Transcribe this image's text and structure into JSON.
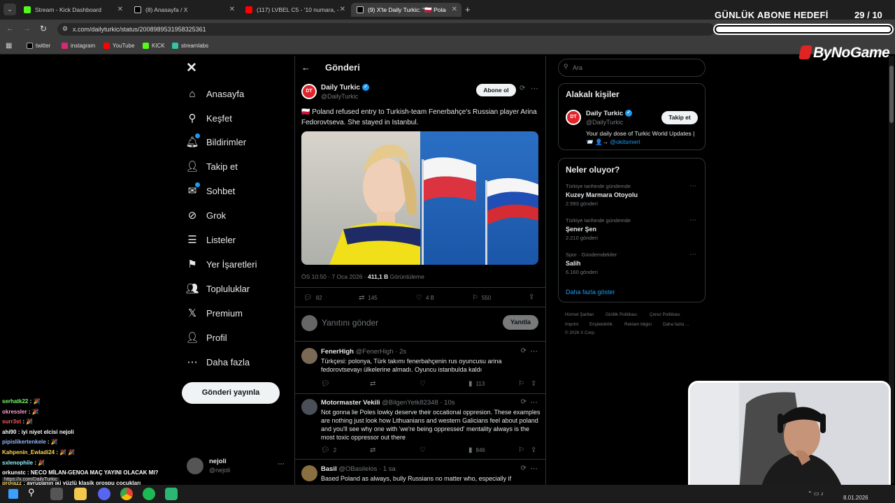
{
  "browser": {
    "tabs": [
      {
        "title": "Stream - Kick Dashboard",
        "color": "#53fc18"
      },
      {
        "title": "(8) Anasayfa / X",
        "color": "#ffffff"
      },
      {
        "title": "(117) LVBEL C5 - '10 numara, -",
        "color": "#ff0000"
      },
      {
        "title": "(9) X'te Daily Turkic: \"🇵🇱 Poland",
        "color": "#ffffff"
      }
    ],
    "url": "x.com/dailyturkic/status/2008989531958325361",
    "bookmarks": [
      "twitter",
      "instagram",
      "YouTube",
      "KICK",
      "streamlabs"
    ]
  },
  "overlay": {
    "goal_title": "GÜNLÜK ABONE HEDEFİ",
    "goal_current": "29",
    "goal_target": "/ 10",
    "goal_fill": 1.0,
    "brand": "ByNoGame",
    "date": "8.01.2026"
  },
  "nav": {
    "items": [
      {
        "label": "Anasayfa",
        "icon": "home-icon",
        "glyph": "⌂"
      },
      {
        "label": "Keşfet",
        "icon": "search-icon",
        "glyph": "⚲"
      },
      {
        "label": "Bildirimler",
        "icon": "bell-icon",
        "glyph": "🔔︎"
      },
      {
        "label": "Takip et",
        "icon": "follow-icon",
        "glyph": "👤︎"
      },
      {
        "label": "Sohbet",
        "icon": "chat-icon",
        "glyph": "✉"
      },
      {
        "label": "Grok",
        "icon": "grok-icon",
        "glyph": "⊘"
      },
      {
        "label": "Listeler",
        "icon": "list-icon",
        "glyph": "☰"
      },
      {
        "label": "Yer İşaretleri",
        "icon": "bookmark-icon",
        "glyph": "⚑"
      },
      {
        "label": "Topluluklar",
        "icon": "communities-icon",
        "glyph": "👥︎"
      },
      {
        "label": "Premium",
        "icon": "x-logo-icon",
        "glyph": "𝕏"
      },
      {
        "label": "Profil",
        "icon": "profile-icon",
        "glyph": "👤︎"
      },
      {
        "label": "Daha fazla",
        "icon": "more-icon",
        "glyph": "⋯"
      }
    ],
    "post_button": "Gönderi yayınla",
    "account_name": "nejoli",
    "account_handle": "@nejoli"
  },
  "post": {
    "header_title": "Gönderi",
    "author_name": "Daily Turkic",
    "author_handle": "@DailyTurkic",
    "avatar_text": "DT",
    "subscribe_label": "Abone ol",
    "text": "🇵🇱 Poland refused entry to Turkish-team Fenerbahçe's Russian player Arina Fedorovtseva. She stayed in Istanbul.",
    "meta_time": "ÖS 10:50 · 7 Oca 2026 · ",
    "meta_views": "411,1 B",
    "meta_views_label": " Görüntüleme",
    "replies": "82",
    "reposts": "145",
    "likes": "4 B",
    "bookmarks": "550",
    "reply_placeholder": "Yanıtını gönder",
    "reply_button": "Yanıtla"
  },
  "replies": [
    {
      "name": "FenerHigh",
      "handle": "@FenerHigh · 2s",
      "text": "Türkçesi: polonya, Türk takımı fenerbahçenin rus oyuncusu arina fedorovtsevayı ülkelerine almadı. Oyuncu istanbulda kaldı",
      "replies": "",
      "views": "113"
    },
    {
      "name": "Motormaster Vekili",
      "handle": "@BilgenYetk82348 · 10s",
      "text": "Not gonna lie Poles lowky deserve their occational oppresion. These examples are nothing just look how Lithuanians and western Galicians feel about poland and you'll see why one with 'we're being oppressed' mentality always is the most toxic oppressor out there",
      "replies": "2",
      "views": "846"
    },
    {
      "name": "Basil",
      "handle": "@OBasilelos · 1 sa",
      "text": "Based Poland as always, bully Russians no matter who, especially if",
      "replies": "",
      "views": ""
    }
  ],
  "sidebar": {
    "search_placeholder": "Ara",
    "related_title": "Alakalı kişiler",
    "related_name": "Daily Turkic",
    "related_handle": "@DailyTurkic",
    "related_bio": "Your daily dose of Turkic World Updates | 📨 👤→ ",
    "related_bio_link": "@okitsmert",
    "follow_button": "Takip et",
    "trends_title": "Neler oluyor?",
    "trends": [
      {
        "category": "Türkiye tarihinde gündemde",
        "name": "Kuzey Marmara Otoyolu",
        "count": "2.593 gönderi"
      },
      {
        "category": "Türkiye tarihinde gündemde",
        "name": "Şener Şen",
        "count": "2.210 gönderi"
      },
      {
        "category": "Spor · Gündemdekiler",
        "name": "Salih",
        "count": "6.160 gönderi"
      }
    ],
    "show_more": "Daha fazla göster",
    "footer": [
      "Hizmet Şartları",
      "Gizlilik Politikası",
      "Çerez Politikası",
      "Imprint",
      "Erişilebilirlik",
      "Reklam bilgisi",
      "Daha fazla ...",
      "© 2026 X Corp."
    ]
  },
  "chat": [
    {
      "user": "serhatk22",
      "msg": " : 🎉",
      "color": "#7cfc6a"
    },
    {
      "user": "okressler",
      "msg": " : 🎉",
      "color": "#ff9bd2"
    },
    {
      "user": "surr3st",
      "msg": " : 🎉",
      "color": "#ff5a5a"
    },
    {
      "user": "ahi90",
      "msg": " : iyi niyet elcisi nejoli",
      "color": "#ffffff"
    },
    {
      "user": "pipislikertenkele",
      "msg": " : 🎉",
      "color": "#8fb7ff"
    },
    {
      "user": "Kahpenin_Ewladi24",
      "msg": " : 🎉 🎉",
      "color": "#ffd84a"
    },
    {
      "user": "sxlenophile",
      "msg": " : 🎉",
      "color": "#8ff0ff"
    },
    {
      "user": "orkunstc",
      "msg": " : NECO MİLAN-GENOA MAÇ YAYINI OLACAK MI?",
      "color": "#ffffff"
    },
    {
      "user": "brofazz",
      "msg": " : avrupanın iki yüzlü klasik orospu cocukları",
      "color": "#ffe066"
    }
  ],
  "status_link": "https://x.com/DailyTurkic"
}
